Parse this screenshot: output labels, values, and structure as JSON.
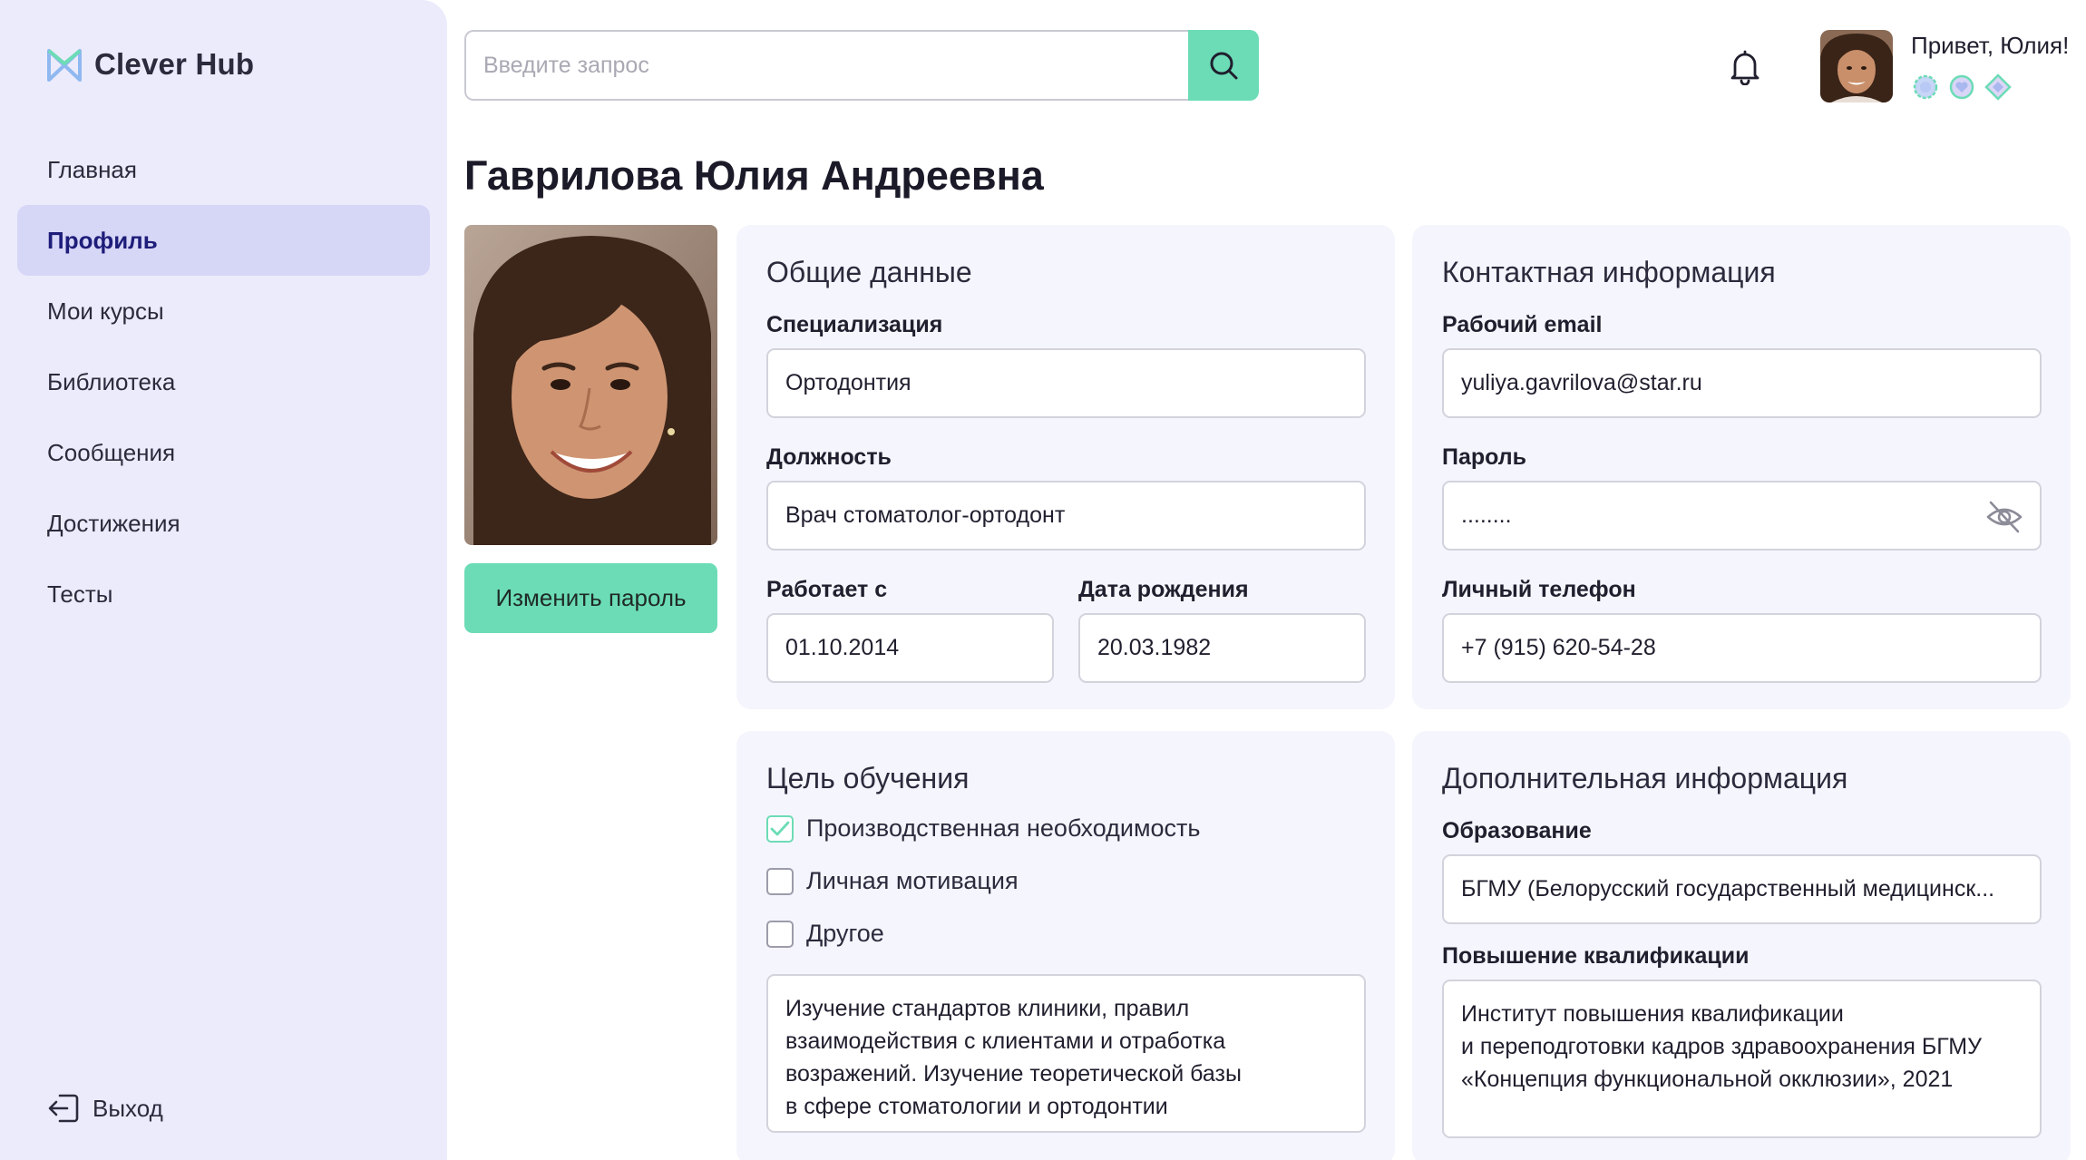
{
  "app": {
    "name": "Clever Hub"
  },
  "sidebar": {
    "items": [
      {
        "label": "Главная"
      },
      {
        "label": "Профиль"
      },
      {
        "label": "Мои курсы"
      },
      {
        "label": "Библиотека"
      },
      {
        "label": "Сообщения"
      },
      {
        "label": "Достижения"
      },
      {
        "label": "Тесты"
      }
    ],
    "logout_label": "Выход"
  },
  "header": {
    "search_placeholder": "Введите запрос",
    "greeting": "Привет, Юлия!"
  },
  "profile": {
    "full_name": "Гаврилова Юлия Андреевна",
    "change_password_label": "Изменить пароль"
  },
  "general": {
    "title": "Общие данные",
    "specialization_label": "Специализация",
    "specialization_value": "Ортодонтия",
    "position_label": "Должность",
    "position_value": "Врач стоматолог-ортодонт",
    "works_since_label": "Работает с",
    "works_since_value": "01.10.2014",
    "birth_date_label": "Дата рождения",
    "birth_date_value": "20.03.1982"
  },
  "contact": {
    "title": "Контактная информация",
    "email_label": "Рабочий email",
    "email_value": "yuliya.gavrilova@star.ru",
    "password_label": "Пароль",
    "password_value": "........",
    "phone_label": "Личный телефон",
    "phone_value": "+7 (915) 620-54-28"
  },
  "goal": {
    "title": "Цель обучения",
    "options": [
      {
        "label": "Производственная необходимость",
        "checked": true
      },
      {
        "label": "Личная мотивация",
        "checked": false
      },
      {
        "label": "Другое",
        "checked": false
      }
    ],
    "text_lines": [
      "Изучение стандартов клиники, правил",
      "взаимодействия с клиентами и отработка",
      "возражений. Изучение теоретической базы",
      "в сфере стоматологии и ортодонтии"
    ]
  },
  "additional": {
    "title": "Дополнительная информация",
    "education_label": "Образование",
    "education_value": "БГМУ (Белорусский государственный медицинск...",
    "qualification_label": "Повышение квалификации",
    "qualification_lines": [
      "Институт повышения квалификации",
      "и переподготовки кадров здравоохранения БГМУ",
      "«Концепция функциональной окклюзии», 2021"
    ]
  },
  "colors": {
    "accent": "#6cdcb6",
    "sidebar_bg": "#ecebfb",
    "active_nav": "#d6d6f7",
    "card_bg": "#f5f5fd"
  }
}
